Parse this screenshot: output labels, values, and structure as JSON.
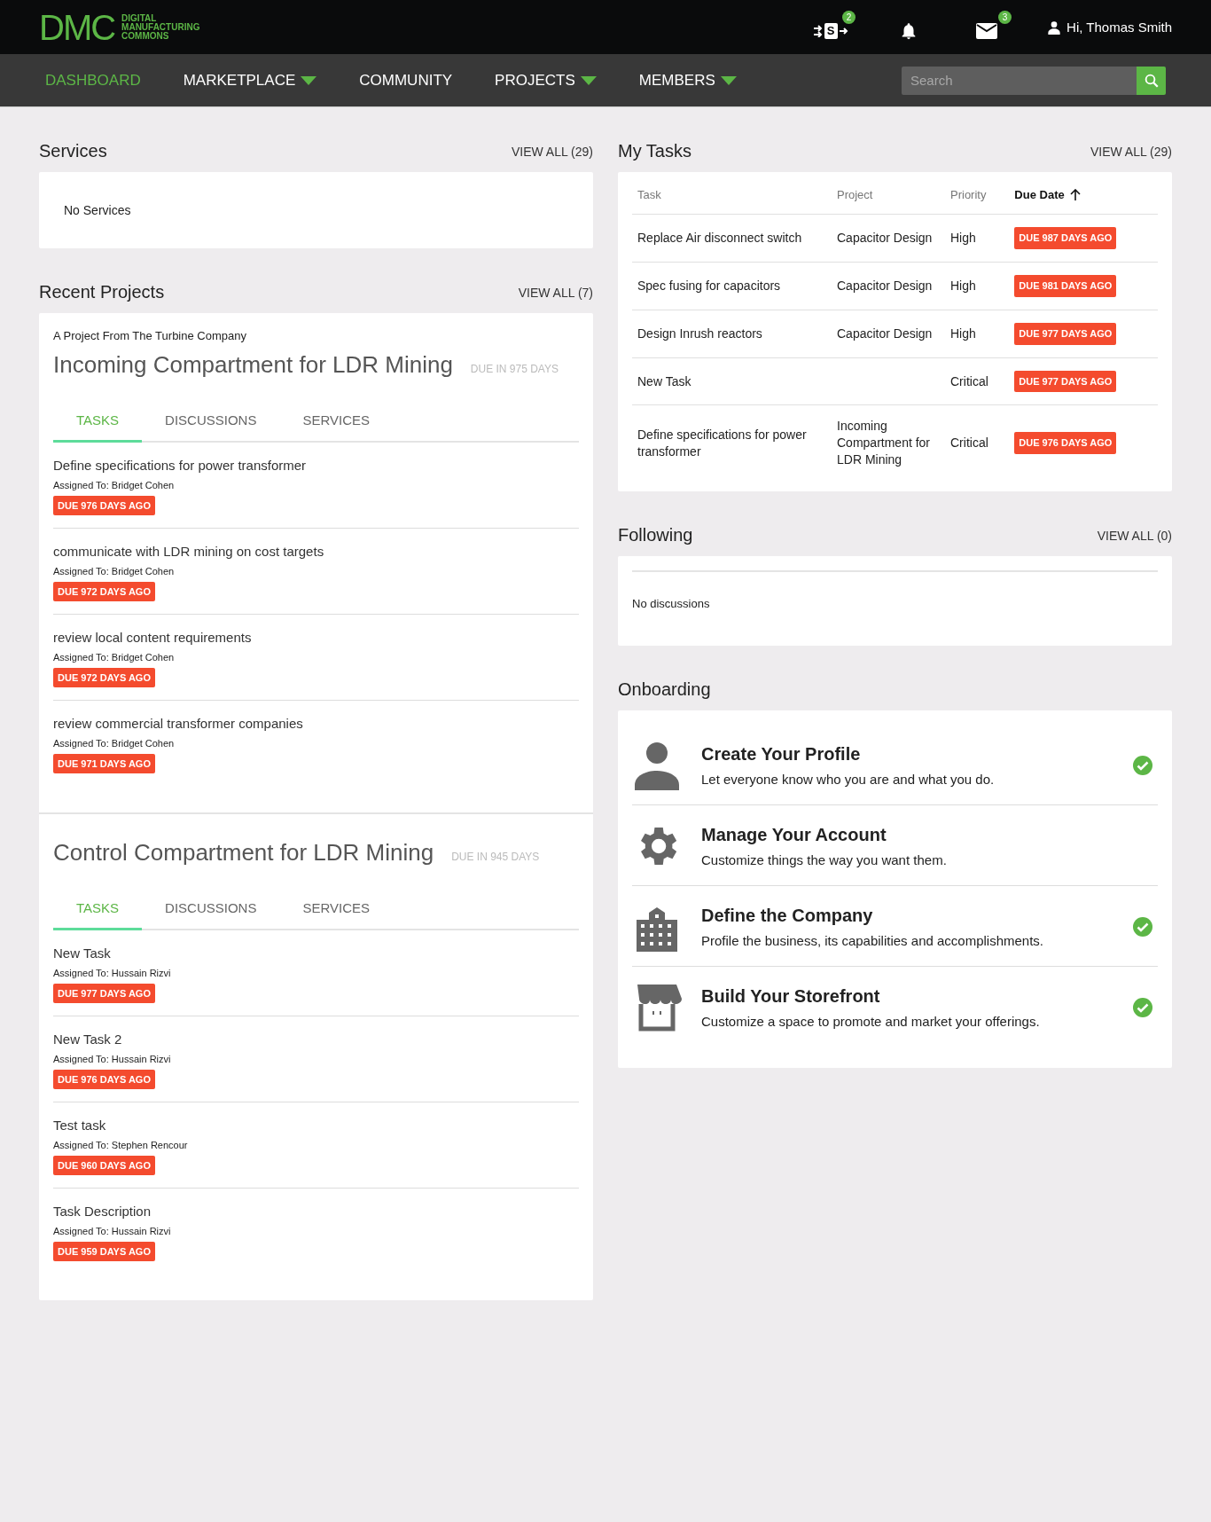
{
  "header": {
    "logo": {
      "mark": "DMC",
      "lines": [
        "DIGITAL",
        "MANUFACTURING",
        "COMMONS"
      ]
    },
    "icons": [
      {
        "kind": "transfer",
        "letter": "S",
        "badge": "2"
      },
      {
        "kind": "bell"
      },
      {
        "kind": "mail",
        "badge": "3"
      }
    ],
    "user": "Hi, Thomas Smith"
  },
  "nav": {
    "items": [
      {
        "label": "DASHBOARD",
        "selected": true,
        "dropdown": false
      },
      {
        "label": "MARKETPLACE",
        "selected": false,
        "dropdown": true
      },
      {
        "label": "COMMUNITY",
        "selected": false,
        "dropdown": false
      },
      {
        "label": "PROJECTS",
        "selected": false,
        "dropdown": true
      },
      {
        "label": "MEMBERS",
        "selected": false,
        "dropdown": true
      }
    ],
    "search": {
      "placeholder": "Search"
    }
  },
  "services": {
    "title": "Services",
    "view_all": "VIEW ALL (29)",
    "empty": "No Services"
  },
  "recent_projects": {
    "title": "Recent Projects",
    "view_all": "VIEW ALL (7)",
    "projects": [
      {
        "owner": "A Project From The Turbine Company",
        "name": "Incoming Compartment for LDR Mining",
        "due": "DUE IN 975 DAYS",
        "tabs": [
          {
            "label": "TASKS",
            "selected": true
          },
          {
            "label": "DISCUSSIONS",
            "selected": false
          },
          {
            "label": "SERVICES",
            "selected": false
          }
        ],
        "tasks": [
          {
            "title": "Define specifications for power transformer",
            "assigned": "Assigned To: Bridget Cohen",
            "due": "DUE 976 DAYS AGO"
          },
          {
            "title": "communicate with LDR mining on cost targets",
            "assigned": "Assigned To: Bridget Cohen",
            "due": "DUE 972 DAYS AGO"
          },
          {
            "title": "review local content requirements",
            "assigned": "Assigned To: Bridget Cohen",
            "due": "DUE 972 DAYS AGO"
          },
          {
            "title": "review commercial transformer companies",
            "assigned": "Assigned To: Bridget Cohen",
            "due": "DUE 971 DAYS AGO"
          }
        ]
      },
      {
        "name": "Control Compartment for LDR Mining",
        "due": "DUE IN 945 DAYS",
        "tabs": [
          {
            "label": "TASKS",
            "selected": true
          },
          {
            "label": "DISCUSSIONS",
            "selected": false
          },
          {
            "label": "SERVICES",
            "selected": false
          }
        ],
        "tasks": [
          {
            "title": "New Task",
            "assigned": "Assigned To: Hussain Rizvi",
            "due": "DUE 977 DAYS AGO"
          },
          {
            "title": "New Task 2",
            "assigned": "Assigned To: Hussain Rizvi",
            "due": "DUE 976 DAYS AGO"
          },
          {
            "title": "Test task",
            "assigned": "Assigned To: Stephen Rencour",
            "due": "DUE 960 DAYS AGO"
          },
          {
            "title": "Task Description",
            "assigned": "Assigned To: Hussain Rizvi",
            "due": "DUE 959 DAYS AGO"
          }
        ]
      }
    ]
  },
  "my_tasks": {
    "title": "My Tasks",
    "view_all": "VIEW ALL (29)",
    "columns": [
      {
        "label": "Task",
        "sorted": false
      },
      {
        "label": "Project",
        "sorted": false
      },
      {
        "label": "Priority",
        "sorted": false
      },
      {
        "label": "Due Date",
        "sorted": true
      }
    ],
    "rows": [
      {
        "task": "Replace Air disconnect switch",
        "project": "Capacitor Design",
        "priority": "High",
        "due": "DUE 987 DAYS AGO"
      },
      {
        "task": "Spec fusing for capacitors",
        "project": "Capacitor Design",
        "priority": "High",
        "due": "DUE 981 DAYS AGO"
      },
      {
        "task": "Design Inrush reactors",
        "project": "Capacitor Design",
        "priority": "High",
        "due": "DUE 977 DAYS AGO"
      },
      {
        "task": "New Task",
        "priority": "Critical",
        "due": "DUE 977 DAYS AGO"
      },
      {
        "task": "Define specifications for power transformer",
        "project": "Incoming Compartment for LDR Mining",
        "priority": "Critical",
        "due": "DUE 976 DAYS AGO"
      }
    ]
  },
  "following": {
    "title": "Following",
    "view_all": "VIEW ALL (0)",
    "empty": "No discussions"
  },
  "onboarding": {
    "title": "Onboarding",
    "steps": [
      {
        "kind": "profile",
        "title": "Create Your Profile",
        "text": "Let everyone know who you are and what you do.",
        "completed": true
      },
      {
        "kind": "account",
        "title": "Manage Your Account",
        "text": "Customize things the way you want them.",
        "completed": false
      },
      {
        "kind": "company",
        "title": "Define the Company",
        "text": "Profile the business, its capabilities and accomplishments.",
        "completed": true
      },
      {
        "kind": "storefront",
        "title": "Build Your Storefront",
        "text": "Customize a space to promote and market your offerings.",
        "completed": true
      }
    ]
  }
}
